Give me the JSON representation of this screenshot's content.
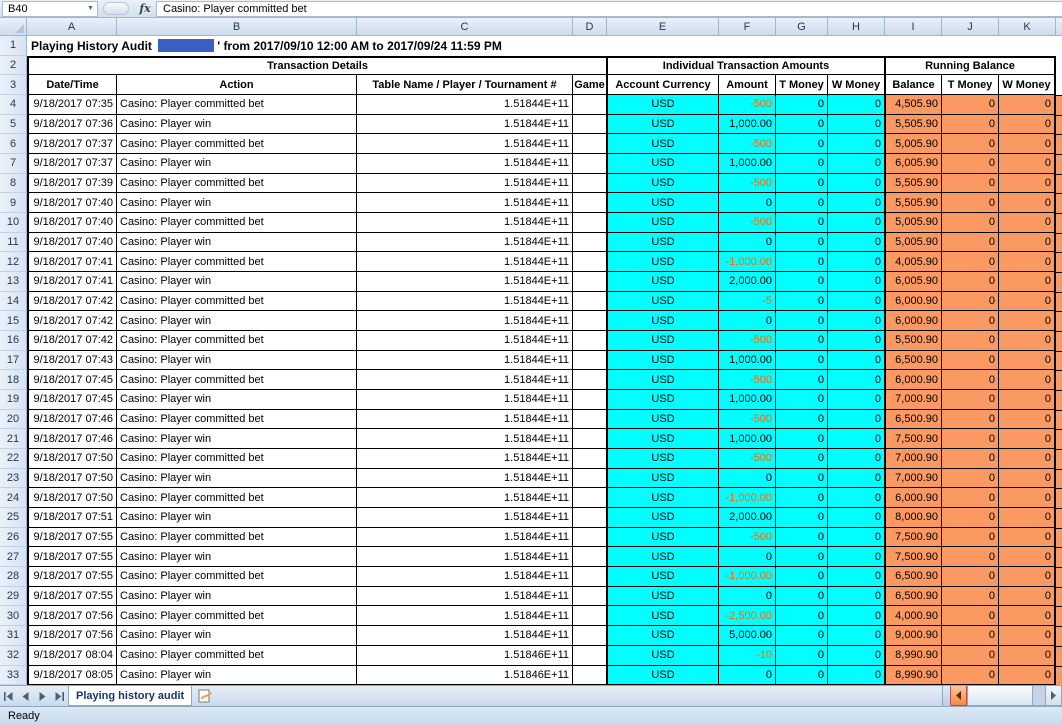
{
  "formula_bar": {
    "cell_reference": "B40",
    "formula": "Casino: Player committed bet"
  },
  "columns": [
    "A",
    "B",
    "C",
    "D",
    "E",
    "F",
    "G",
    "H",
    "I",
    "J",
    "K"
  ],
  "row_numbers": [
    "1",
    "2",
    "3"
  ],
  "title_row": {
    "prefix": "Playing History Audit ",
    "suffix": "' from 2017/09/10 12:00 AM to 2017/09/24 11:59 PM"
  },
  "group_headers": [
    "Transaction Details",
    "Individual Transaction Amounts",
    "Running Balance"
  ],
  "column_headers": [
    "Date/Time",
    "Action",
    "Table Name / Player / Tournament #",
    "Game",
    "Account Currency",
    "Amount",
    "T Money",
    "W Money",
    "Balance",
    "T Money",
    "W Money"
  ],
  "rows": [
    {
      "n": "4",
      "datetime": "9/18/2017 07:35",
      "action": "Casino: Player committed bet",
      "ref": "1.51844E+11",
      "game": "",
      "currency": "USD",
      "amount": "-500",
      "t1": "0",
      "w1": "0",
      "balance": "4,505.90",
      "t2": "0",
      "w2": "0"
    },
    {
      "n": "5",
      "datetime": "9/18/2017 07:36",
      "action": "Casino: Player win",
      "ref": "1.51844E+11",
      "game": "",
      "currency": "USD",
      "amount": "1,000.00",
      "t1": "0",
      "w1": "0",
      "balance": "5,505.90",
      "t2": "0",
      "w2": "0"
    },
    {
      "n": "6",
      "datetime": "9/18/2017 07:37",
      "action": "Casino: Player committed bet",
      "ref": "1.51844E+11",
      "game": "",
      "currency": "USD",
      "amount": "-500",
      "t1": "0",
      "w1": "0",
      "balance": "5,005.90",
      "t2": "0",
      "w2": "0"
    },
    {
      "n": "7",
      "datetime": "9/18/2017 07:37",
      "action": "Casino: Player win",
      "ref": "1.51844E+11",
      "game": "",
      "currency": "USD",
      "amount": "1,000.00",
      "t1": "0",
      "w1": "0",
      "balance": "6,005.90",
      "t2": "0",
      "w2": "0"
    },
    {
      "n": "8",
      "datetime": "9/18/2017 07:39",
      "action": "Casino: Player committed bet",
      "ref": "1.51844E+11",
      "game": "",
      "currency": "USD",
      "amount": "-500",
      "t1": "0",
      "w1": "0",
      "balance": "5,505.90",
      "t2": "0",
      "w2": "0"
    },
    {
      "n": "9",
      "datetime": "9/18/2017 07:40",
      "action": "Casino: Player win",
      "ref": "1.51844E+11",
      "game": "",
      "currency": "USD",
      "amount": "0",
      "t1": "0",
      "w1": "0",
      "balance": "5,505.90",
      "t2": "0",
      "w2": "0"
    },
    {
      "n": "10",
      "datetime": "9/18/2017 07:40",
      "action": "Casino: Player committed bet",
      "ref": "1.51844E+11",
      "game": "",
      "currency": "USD",
      "amount": "-500",
      "t1": "0",
      "w1": "0",
      "balance": "5,005.90",
      "t2": "0",
      "w2": "0"
    },
    {
      "n": "11",
      "datetime": "9/18/2017 07:40",
      "action": "Casino: Player win",
      "ref": "1.51844E+11",
      "game": "",
      "currency": "USD",
      "amount": "0",
      "t1": "0",
      "w1": "0",
      "balance": "5,005.90",
      "t2": "0",
      "w2": "0"
    },
    {
      "n": "12",
      "datetime": "9/18/2017 07:41",
      "action": "Casino: Player committed bet",
      "ref": "1.51844E+11",
      "game": "",
      "currency": "USD",
      "amount": "-1,000.00",
      "t1": "0",
      "w1": "0",
      "balance": "4,005.90",
      "t2": "0",
      "w2": "0"
    },
    {
      "n": "13",
      "datetime": "9/18/2017 07:41",
      "action": "Casino: Player win",
      "ref": "1.51844E+11",
      "game": "",
      "currency": "USD",
      "amount": "2,000.00",
      "t1": "0",
      "w1": "0",
      "balance": "6,005.90",
      "t2": "0",
      "w2": "0"
    },
    {
      "n": "14",
      "datetime": "9/18/2017 07:42",
      "action": "Casino: Player committed bet",
      "ref": "1.51844E+11",
      "game": "",
      "currency": "USD",
      "amount": "-5",
      "t1": "0",
      "w1": "0",
      "balance": "6,000.90",
      "t2": "0",
      "w2": "0"
    },
    {
      "n": "15",
      "datetime": "9/18/2017 07:42",
      "action": "Casino: Player win",
      "ref": "1.51844E+11",
      "game": "",
      "currency": "USD",
      "amount": "0",
      "t1": "0",
      "w1": "0",
      "balance": "6,000.90",
      "t2": "0",
      "w2": "0"
    },
    {
      "n": "16",
      "datetime": "9/18/2017 07:42",
      "action": "Casino: Player committed bet",
      "ref": "1.51844E+11",
      "game": "",
      "currency": "USD",
      "amount": "-500",
      "t1": "0",
      "w1": "0",
      "balance": "5,500.90",
      "t2": "0",
      "w2": "0"
    },
    {
      "n": "17",
      "datetime": "9/18/2017 07:43",
      "action": "Casino: Player win",
      "ref": "1.51844E+11",
      "game": "",
      "currency": "USD",
      "amount": "1,000.00",
      "t1": "0",
      "w1": "0",
      "balance": "6,500.90",
      "t2": "0",
      "w2": "0"
    },
    {
      "n": "18",
      "datetime": "9/18/2017 07:45",
      "action": "Casino: Player committed bet",
      "ref": "1.51844E+11",
      "game": "",
      "currency": "USD",
      "amount": "-500",
      "t1": "0",
      "w1": "0",
      "balance": "6,000.90",
      "t2": "0",
      "w2": "0"
    },
    {
      "n": "19",
      "datetime": "9/18/2017 07:45",
      "action": "Casino: Player win",
      "ref": "1.51844E+11",
      "game": "",
      "currency": "USD",
      "amount": "1,000.00",
      "t1": "0",
      "w1": "0",
      "balance": "7,000.90",
      "t2": "0",
      "w2": "0"
    },
    {
      "n": "20",
      "datetime": "9/18/2017 07:46",
      "action": "Casino: Player committed bet",
      "ref": "1.51844E+11",
      "game": "",
      "currency": "USD",
      "amount": "-500",
      "t1": "0",
      "w1": "0",
      "balance": "6,500.90",
      "t2": "0",
      "w2": "0"
    },
    {
      "n": "21",
      "datetime": "9/18/2017 07:46",
      "action": "Casino: Player win",
      "ref": "1.51844E+11",
      "game": "",
      "currency": "USD",
      "amount": "1,000.00",
      "t1": "0",
      "w1": "0",
      "balance": "7,500.90",
      "t2": "0",
      "w2": "0"
    },
    {
      "n": "22",
      "datetime": "9/18/2017 07:50",
      "action": "Casino: Player committed bet",
      "ref": "1.51844E+11",
      "game": "",
      "currency": "USD",
      "amount": "-500",
      "t1": "0",
      "w1": "0",
      "balance": "7,000.90",
      "t2": "0",
      "w2": "0"
    },
    {
      "n": "23",
      "datetime": "9/18/2017 07:50",
      "action": "Casino: Player win",
      "ref": "1.51844E+11",
      "game": "",
      "currency": "USD",
      "amount": "0",
      "t1": "0",
      "w1": "0",
      "balance": "7,000.90",
      "t2": "0",
      "w2": "0"
    },
    {
      "n": "24",
      "datetime": "9/18/2017 07:50",
      "action": "Casino: Player committed bet",
      "ref": "1.51844E+11",
      "game": "",
      "currency": "USD",
      "amount": "-1,000.00",
      "t1": "0",
      "w1": "0",
      "balance": "6,000.90",
      "t2": "0",
      "w2": "0"
    },
    {
      "n": "25",
      "datetime": "9/18/2017 07:51",
      "action": "Casino: Player win",
      "ref": "1.51844E+11",
      "game": "",
      "currency": "USD",
      "amount": "2,000.00",
      "t1": "0",
      "w1": "0",
      "balance": "8,000.90",
      "t2": "0",
      "w2": "0"
    },
    {
      "n": "26",
      "datetime": "9/18/2017 07:55",
      "action": "Casino: Player committed bet",
      "ref": "1.51844E+11",
      "game": "",
      "currency": "USD",
      "amount": "-500",
      "t1": "0",
      "w1": "0",
      "balance": "7,500.90",
      "t2": "0",
      "w2": "0"
    },
    {
      "n": "27",
      "datetime": "9/18/2017 07:55",
      "action": "Casino: Player win",
      "ref": "1.51844E+11",
      "game": "",
      "currency": "USD",
      "amount": "0",
      "t1": "0",
      "w1": "0",
      "balance": "7,500.90",
      "t2": "0",
      "w2": "0"
    },
    {
      "n": "28",
      "datetime": "9/18/2017 07:55",
      "action": "Casino: Player committed bet",
      "ref": "1.51844E+11",
      "game": "",
      "currency": "USD",
      "amount": "-1,000.00",
      "t1": "0",
      "w1": "0",
      "balance": "6,500.90",
      "t2": "0",
      "w2": "0"
    },
    {
      "n": "29",
      "datetime": "9/18/2017 07:55",
      "action": "Casino: Player win",
      "ref": "1.51844E+11",
      "game": "",
      "currency": "USD",
      "amount": "0",
      "t1": "0",
      "w1": "0",
      "balance": "6,500.90",
      "t2": "0",
      "w2": "0"
    },
    {
      "n": "30",
      "datetime": "9/18/2017 07:56",
      "action": "Casino: Player committed bet",
      "ref": "1.51844E+11",
      "game": "",
      "currency": "USD",
      "amount": "-2,500.00",
      "t1": "0",
      "w1": "0",
      "balance": "4,000.90",
      "t2": "0",
      "w2": "0"
    },
    {
      "n": "31",
      "datetime": "9/18/2017 07:56",
      "action": "Casino: Player win",
      "ref": "1.51844E+11",
      "game": "",
      "currency": "USD",
      "amount": "5,000.00",
      "t1": "0",
      "w1": "0",
      "balance": "9,000.90",
      "t2": "0",
      "w2": "0"
    },
    {
      "n": "32",
      "datetime": "9/18/2017 08:04",
      "action": "Casino: Player committed bet",
      "ref": "1.51846E+11",
      "game": "",
      "currency": "USD",
      "amount": "-10",
      "t1": "0",
      "w1": "0",
      "balance": "8,990.90",
      "t2": "0",
      "w2": "0"
    },
    {
      "n": "33",
      "datetime": "9/18/2017 08:05",
      "action": "Casino: Player win",
      "ref": "1.51846E+11",
      "game": "",
      "currency": "USD",
      "amount": "0",
      "t1": "0",
      "w1": "0",
      "balance": "8,990.90",
      "t2": "0",
      "w2": "0"
    }
  ],
  "sheet_tab": {
    "label": "Playing history audit"
  },
  "status_bar": {
    "ready": "Ready"
  },
  "colors": {
    "cyan_fill": "#00FFFF",
    "orange_fill": "#FA9A62",
    "negative_text": "#FF6600",
    "redaction_blue": "#3A5FC5"
  }
}
